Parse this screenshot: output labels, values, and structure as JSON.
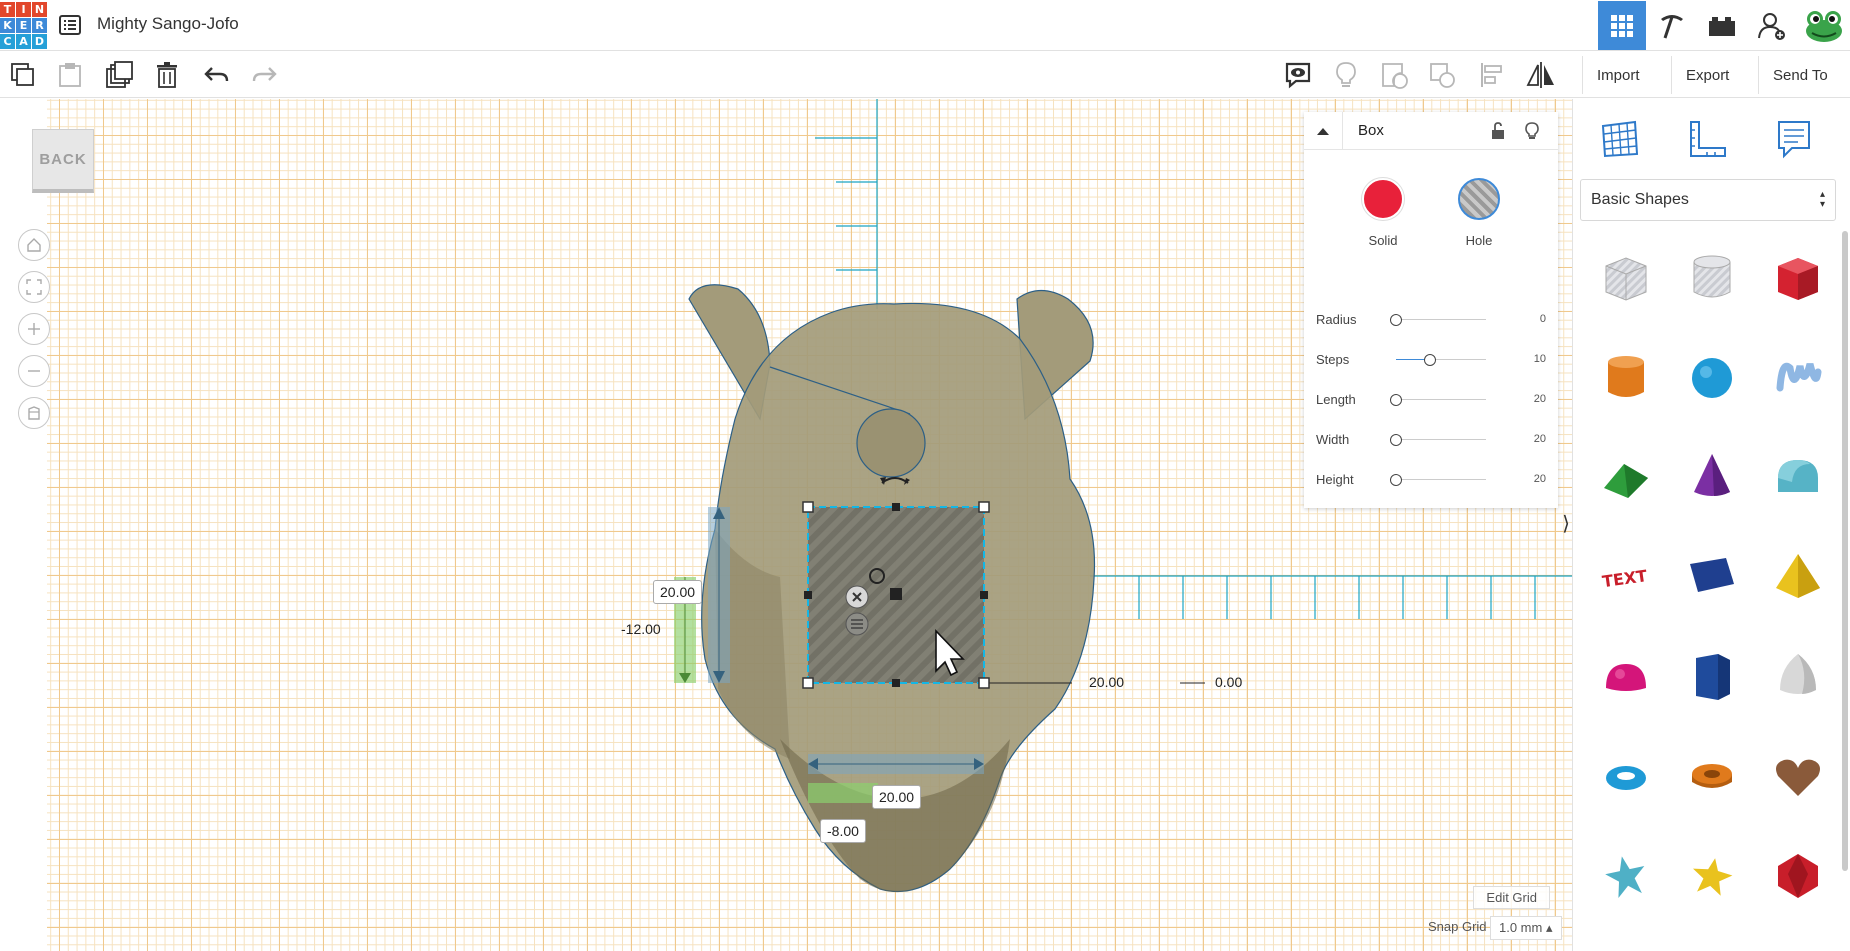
{
  "app": {
    "logo_letters": [
      "T",
      "I",
      "N",
      "K",
      "E",
      "R",
      "C",
      "A",
      "D"
    ],
    "logo_colors": [
      "#e2472b",
      "#e2472b",
      "#e2472b",
      "#3e8ad8",
      "#3e8ad8",
      "#3e8ad8",
      "#26a0d8",
      "#26a0d8",
      "#26a0d8"
    ],
    "project_title": "Mighty Sango-Jofo",
    "accent_color": "#3e8ad8"
  },
  "header": {
    "view_buttons": [
      {
        "icon": "grid-view-icon",
        "active": true
      },
      {
        "icon": "pickaxe-icon",
        "active": false
      },
      {
        "icon": "bricks-icon",
        "active": false
      },
      {
        "icon": "add-user-icon",
        "active": false
      },
      {
        "icon": "frog-avatar-icon",
        "active": false
      }
    ]
  },
  "toolbar": {
    "import_label": "Import",
    "export_label": "Export",
    "send_to_label": "Send To"
  },
  "workplane": {
    "back_label": "BACK",
    "height_value": "20.00",
    "elevation_value": "-12.00",
    "length_value": "20.00",
    "x_offset_value": "0.00",
    "width_value": "20.00",
    "y_offset_value": "-8.00",
    "edit_grid_label": "Edit Grid",
    "snap_grid_label": "Snap Grid",
    "snap_grid_value": "1.0 mm",
    "snap_grid_arrow": "▴"
  },
  "inspector": {
    "title": "Box",
    "solid_label": "Solid",
    "hole_label": "Hole",
    "solid_color": "#e8213a",
    "properties": [
      {
        "label": "Radius",
        "value": "0",
        "fraction": 0.0
      },
      {
        "label": "Steps",
        "value": "10",
        "fraction": 0.38
      },
      {
        "label": "Length",
        "value": "20",
        "fraction": 0.0
      },
      {
        "label": "Width",
        "value": "20",
        "fraction": 0.0
      },
      {
        "label": "Height",
        "value": "20",
        "fraction": 0.0
      }
    ],
    "collapse_glyph": "⟩"
  },
  "shapes_panel": {
    "category": "Basic Shapes",
    "category_arrows": "▴▾",
    "shapes": [
      {
        "name": "box-hole",
        "color": "#c7c9cf"
      },
      {
        "name": "cylinder-hole",
        "color": "#c7c9cf"
      },
      {
        "name": "box",
        "color": "#d42230"
      },
      {
        "name": "cylinder",
        "color": "#e07a1c"
      },
      {
        "name": "sphere",
        "color": "#1f9ad6"
      },
      {
        "name": "scribble",
        "color": "#8fb7e3"
      },
      {
        "name": "roof",
        "color": "#2e9d3c"
      },
      {
        "name": "cone",
        "color": "#7b2fa3"
      },
      {
        "name": "round-roof",
        "color": "#56b3c6"
      },
      {
        "name": "text",
        "color": "#c81e2a"
      },
      {
        "name": "shape-generator",
        "color": "#1f3f8f"
      },
      {
        "name": "pyramid",
        "color": "#e9c21e"
      },
      {
        "name": "half-sphere",
        "color": "#d4157a"
      },
      {
        "name": "polygon",
        "color": "#1f4b9c"
      },
      {
        "name": "paraboloid",
        "color": "#d8d8d8"
      },
      {
        "name": "torus",
        "color": "#1f9ad6"
      },
      {
        "name": "tube",
        "color": "#e07a1c"
      },
      {
        "name": "heart",
        "color": "#8a5a3a"
      },
      {
        "name": "star",
        "color": "#4fb0c6"
      },
      {
        "name": "star-gold",
        "color": "#e9c21e"
      },
      {
        "name": "icosahedron",
        "color": "#c81e2a"
      }
    ]
  }
}
